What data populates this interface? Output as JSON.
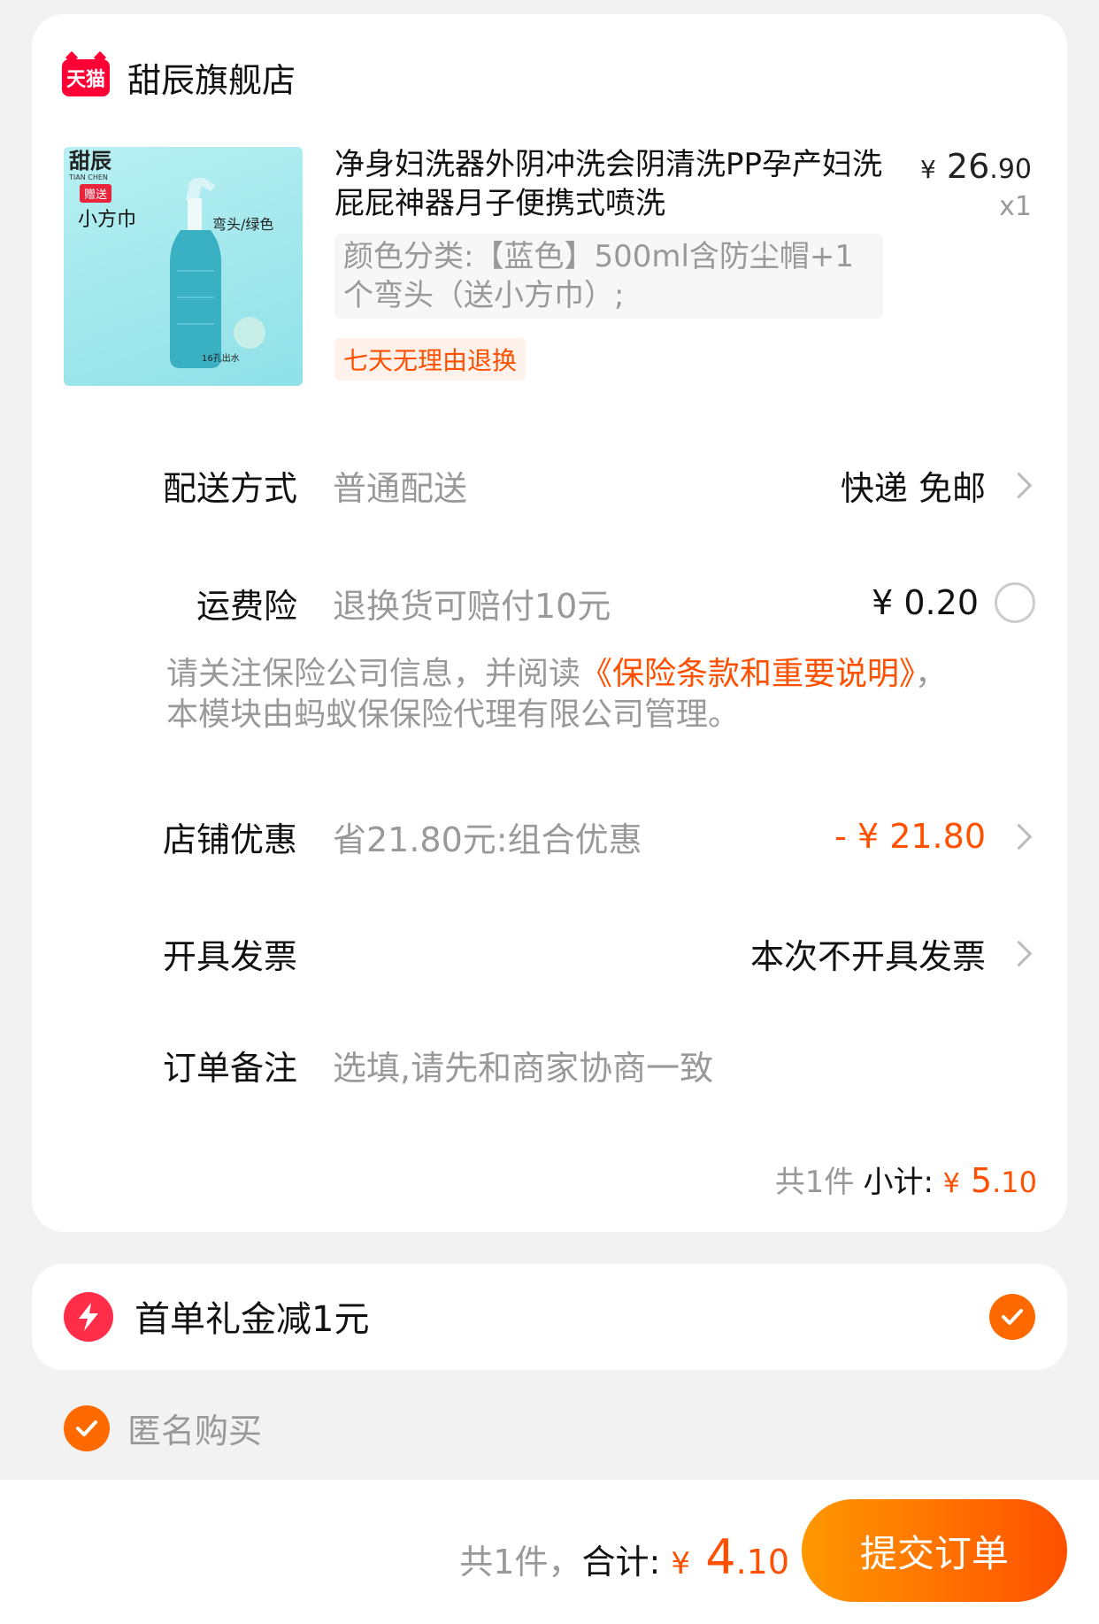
{
  "store": {
    "logo_text": "天猫",
    "name": "甜辰旗舰店"
  },
  "product": {
    "image": {
      "brand": "甜辰",
      "brand_sub": "TIAN CHEN",
      "badge": "赠送",
      "gift": "小方巾",
      "note": "弯头/绿色",
      "small": "16孔出水"
    },
    "title": "净身妇洗器外阴冲洗会阴清洗PP孕产妇洗屁屁神器月子便携式喷洗",
    "price_currency": "¥",
    "price_int": "26",
    "price_dec": ".90",
    "qty": "x1",
    "sku": "颜色分类:【蓝色】500ml含防尘帽+1个弯头（送小方巾）;",
    "tag": "七天无理由退换"
  },
  "rows": {
    "delivery": {
      "label": "配送方式",
      "value": "普通配送",
      "right": "快递 免邮"
    },
    "insurance": {
      "label": "运费险",
      "value": "退换货可赔付10元",
      "right": "¥ 0.20"
    },
    "discount": {
      "label": "店铺优惠",
      "value": "省21.80元:组合优惠",
      "right": "- ¥ 21.80"
    },
    "invoice": {
      "label": "开具发票",
      "right": "本次不开具发票"
    },
    "remark": {
      "label": "订单备注",
      "value": "选填,请先和商家协商一致"
    }
  },
  "notice": {
    "pre": "请关注保险公司信息，并阅读",
    "link": "《保险条款和重要说明》",
    "post": "，本模块由蚂蚁保保险代理有限公司管理。"
  },
  "subtotal": {
    "count": "共1件",
    "label": "小计:",
    "currency": "¥",
    "int": "5",
    "dec": ".10"
  },
  "gift": {
    "text": "首单礼金减1元",
    "checked": true
  },
  "anonymous": {
    "text": "匿名购买",
    "checked": true
  },
  "footer": {
    "count": "共1件，",
    "label": "合计:",
    "currency": "¥",
    "int": "4",
    "dec": ".10",
    "submit": "提交订单"
  },
  "colors": {
    "accent": "#ff5000",
    "tmall": "#ff0036"
  }
}
